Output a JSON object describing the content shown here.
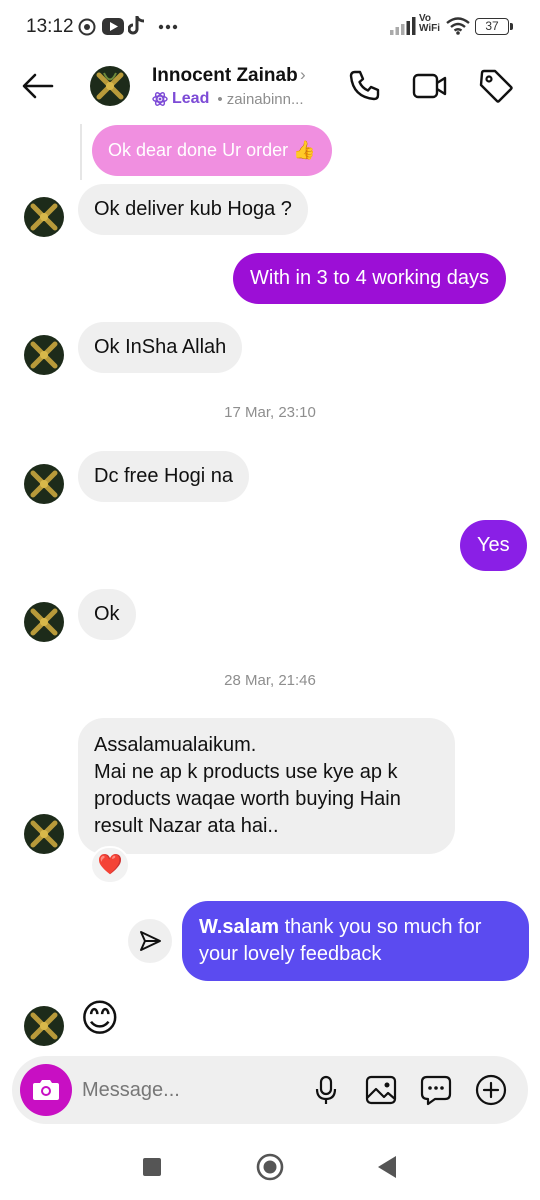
{
  "status_bar": {
    "time": "13:12",
    "vowifi_line1": "Vo",
    "vowifi_line2": "WiFi",
    "battery": "37"
  },
  "header": {
    "contact_name": "Innocent Zainab",
    "lead_label": "Lead",
    "username": "• zainabinn..."
  },
  "messages": [
    {
      "text": "Ok dear done Ur order 👍",
      "from": "me",
      "style": "replied-preview"
    },
    {
      "text": "Ok deliver kub Hoga ?",
      "from": "them"
    },
    {
      "text": "With in 3 to 4 working days",
      "from": "me"
    },
    {
      "text": "Ok InSha Allah",
      "from": "them"
    },
    {
      "timestamp": "17 Mar, 23:10"
    },
    {
      "text": "Dc free Hogi na",
      "from": "them"
    },
    {
      "text": "Yes",
      "from": "me"
    },
    {
      "text": "Ok",
      "from": "them"
    },
    {
      "timestamp": "28 Mar, 21:46"
    },
    {
      "lines": [
        "Assalamualaikum.",
        "Mai ne ap k products use kye ap k",
        "products waqae worth buying Hain",
        "result Nazar ata hai.."
      ],
      "from": "them",
      "reaction": "❤️"
    },
    {
      "bold": "W.salam",
      "rest_line1": " thank you so much for",
      "rest_line2": "your lovely feedback",
      "from": "me"
    },
    {
      "text": "😊",
      "from": "them",
      "style": "emoji"
    }
  ],
  "composer": {
    "placeholder": "Message..."
  },
  "icons": {
    "back": "arrow-left-icon",
    "call": "phone-icon",
    "video": "video-camera-icon",
    "tag": "tag-icon",
    "lead": "lead-atom-icon",
    "share": "send-icon",
    "camera": "camera-icon",
    "mic": "microphone-icon",
    "gallery": "image-icon",
    "sticker": "chat-bubble-icon",
    "add": "plus-circle-icon"
  },
  "colors": {
    "outgoing_bubble": "#9c0fd6",
    "outgoing_bubble_last": "#5b4bf0",
    "incoming_bubble": "#efefef",
    "replied_preview_bubble": "#f08fe0",
    "camera_button": "#c80fc3",
    "lead_purple": "#7d4bd6"
  }
}
